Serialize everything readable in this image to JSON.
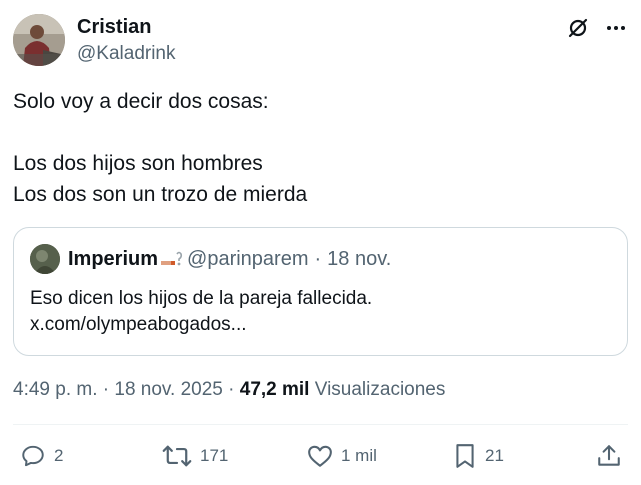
{
  "author": {
    "name": "Cristian",
    "handle": "@Kaladrink"
  },
  "tweet": {
    "lines": [
      "Solo voy a decir dos cosas:",
      "",
      "Los dos hijos son hombres",
      "Los dos son un trozo de mierda"
    ]
  },
  "quote": {
    "name": "Imperium",
    "handle": "@parinparem",
    "separator": "·",
    "date": "18 nov.",
    "text_line1": "Eso dicen los hijos de la pareja fallecida.",
    "text_line2": "x.com/olympeabogados..."
  },
  "meta": {
    "time": "4:49 p. m.",
    "separator": "·",
    "date": "18 nov. 2025",
    "views_count": "47,2 mil",
    "views_label": "Visualizaciones"
  },
  "actions": {
    "replies": "2",
    "retweets": "171",
    "likes": "1 mil",
    "bookmarks": "21"
  },
  "icons": {
    "grok": "grok-icon",
    "more": "more-icon",
    "reply": "reply-icon",
    "retweet": "retweet-icon",
    "like": "heart-icon",
    "bookmark": "bookmark-icon",
    "share": "share-icon"
  },
  "colors": {
    "text_primary": "#0f1419",
    "text_secondary": "#536471",
    "border": "#cfd9de"
  }
}
